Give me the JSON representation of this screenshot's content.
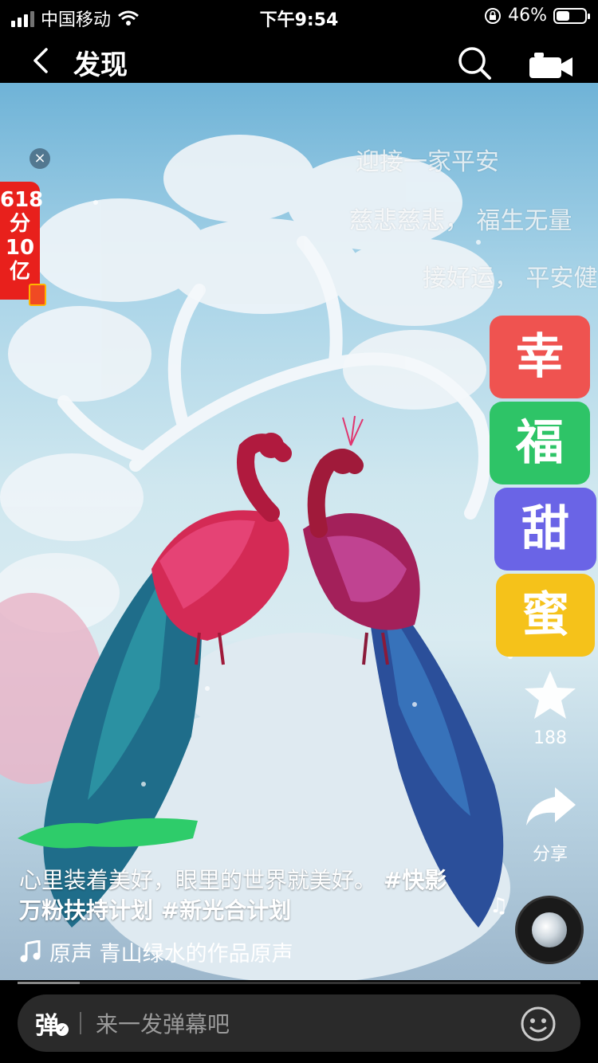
{
  "status_bar": {
    "carrier": "中国移动",
    "time": "下午9:54",
    "battery_percent": "46%",
    "battery_level": 0.46
  },
  "nav": {
    "title": "发现"
  },
  "ad": {
    "lines": [
      "618",
      "分",
      "10",
      "亿"
    ]
  },
  "danmaku": [
    "迎接一家平安",
    "慈悲慈悲， 福生无量",
    "接好运， 平安健"
  ],
  "tiles": [
    {
      "char": "幸",
      "color": "#ef5350"
    },
    {
      "char": "福",
      "color": "#2ec467"
    },
    {
      "char": "甜",
      "color": "#6a64e6"
    },
    {
      "char": "蜜",
      "color": "#f5c21a"
    }
  ],
  "actions": {
    "likes": "188",
    "share_label": "分享"
  },
  "caption": {
    "text": "心里装着美好，眼里的世界就美好。",
    "tags": "#快影万粉扶持计划 #新光合计划"
  },
  "music": {
    "text": "原声   青山绿水的作品原声"
  },
  "progress": 0.11,
  "comment_bar": {
    "danmaku_icon": "弹",
    "placeholder": "来一发弹幕吧"
  },
  "icons": {
    "back": "chevron-left-icon",
    "search": "search-icon",
    "camera": "camera-icon",
    "star": "star-icon",
    "share": "share-icon",
    "music": "music-note-icon",
    "emoji": "emoji-icon"
  }
}
